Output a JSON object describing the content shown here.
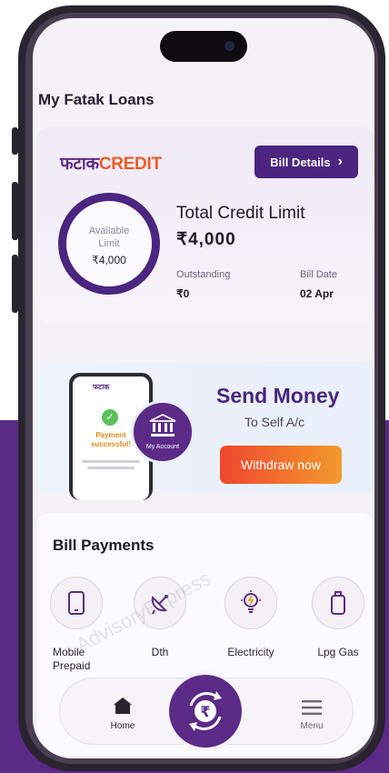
{
  "page": {
    "title": "My Fatak Loans"
  },
  "credit_card": {
    "logo_hindi": "फटाक",
    "logo_english": "CREDIT",
    "bill_button": "Bill Details",
    "bill_button_chevron": "›",
    "ring_label": "Available Limit",
    "ring_value": "₹4,000",
    "total_label": "Total Credit Limit",
    "total_value": "₹4,000",
    "outstanding_label": "Outstanding",
    "outstanding_value": "₹0",
    "bill_date_label": "Bill Date",
    "bill_date_value": "02 Apr"
  },
  "send_money": {
    "title": "Send Money",
    "subtitle": "To Self A/c",
    "button": "Withdraw now",
    "account_badge": "My Account",
    "mini_logo": "फटाक",
    "mini_status": "Payment successful!",
    "mini_check": "✓"
  },
  "bill_payments": {
    "title": "Bill Payments",
    "items": [
      {
        "label": "Mobile Prepaid",
        "icon": "mobile-icon"
      },
      {
        "label": "Dth",
        "icon": "satellite-dish-icon"
      },
      {
        "label": "Electricity",
        "icon": "bulb-icon"
      },
      {
        "label": "Lpg Gas",
        "icon": "gas-cylinder-icon"
      }
    ]
  },
  "watermark": "AdvisoryExpress",
  "nav": {
    "home": "Home",
    "menu": "Menu",
    "center_symbol": "₹"
  },
  "colors": {
    "brand_purple": "#5b2a86",
    "accent_orange": "#f05a28"
  }
}
